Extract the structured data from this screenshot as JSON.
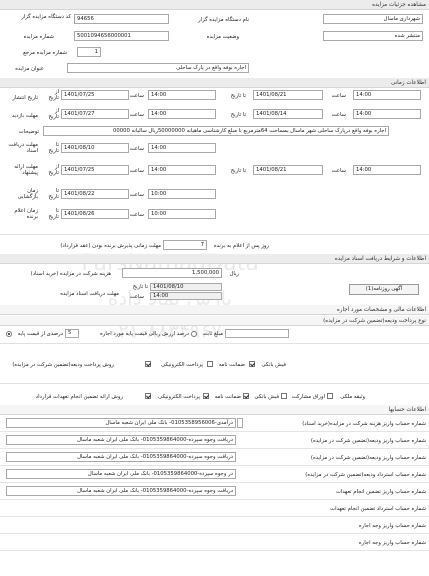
{
  "headers": {
    "detail": "مشاهده جزئیات مزایده",
    "timing": "اطلاعات زمانی",
    "terms": "اطلاعات و شرایط دریافت اسناد مزایده",
    "financial": "اطلاعات مالی و مشخصات مورد اجاره",
    "guarantee_type": "نوع پرداخت ودیعه(تضمین شرکت در مزایده)",
    "accounts": "اطلاعات حسابها"
  },
  "general": {
    "code_label": "کد دستگاه مزایده گزار",
    "code_value": "94656",
    "org_label": "نام دستگاه مزایده گزار",
    "org_value": "شهرداری ماسال",
    "number_label": "شماره مزایده",
    "number_value": "5001094656000001",
    "status_label": "وضعیت مزایده",
    "status_value": "منتشر شده",
    "ref_label": "شماره مزایده مرجع",
    "ref_value": "1",
    "subject_label": "عنوان مزایده",
    "subject_value": "اجاره  بوفه  واقع در پارک ساحلی"
  },
  "timing": {
    "from": "از تاریخ",
    "to": "تا تاریخ",
    "time": "ساعت",
    "publish_label": "تاریخ انتشار",
    "publish_from_date": "1401/07/25",
    "publish_from_time": "14:00",
    "publish_to_date": "1401/08/21",
    "publish_to_time": "14:00",
    "visit_label": "مهلت بازدید",
    "visit_from_date": "1401/07/27",
    "visit_from_time": "14:00",
    "visit_to_date": "1401/08/14",
    "visit_to_time": "14:00",
    "description_label": "توضیحات",
    "description_value": "اجاره بوفه واقع درپارک ساحلی شهر ماسال بمساحت 64مترمربع با مبلغ کارشناسی ماهیانه 50000000ریال سالیانه 00000",
    "doc_deadline_label": "مهلت دریافت اسناد",
    "doc_deadline_date": "1401/08/10",
    "doc_deadline_time": "14:00",
    "offer_deadline_label": "مهلت ارائه پیشنهاد",
    "offer_from_date": "1401/07/25",
    "offer_from_time": "14:00",
    "offer_to_date": "1401/08/21",
    "offer_to_time": "14:00",
    "opening_label": "زمان بازگشایی",
    "opening_date": "1401/08/22",
    "opening_time": "10:00",
    "winner_label": "زمان اعلام برنده",
    "winner_date": "1401/08/26",
    "winner_time": "10:00"
  },
  "terms": {
    "validity_label": "مهلت زمانی پذیرش برنده بودن (عقد قرارداد)",
    "validity_value": "7",
    "validity_suffix": "روز پس از اعلام به برنده",
    "fee_label": "هزینه شرکت در مزایده (خرید اسناد)",
    "fee_value": "1,500,000",
    "fee_unit": "ریال",
    "receipt_label": "مهلت دریافت اسناد مزایده",
    "receipt_to_label": "تا تاریخ",
    "receipt_date": "1401/08/10",
    "receipt_time_label": "ساعت",
    "receipt_time": "14:00",
    "newspaper_button": "آگهی روزنامه(1)"
  },
  "guarantee": {
    "percent_label": "درصدی از قیمت پایه",
    "percent_value": "5",
    "percent_suffix": "درصد ارزش ریالی قیمت پایه مورد اجاره",
    "fixed_label": "مبلغ ثابت"
  },
  "payment": {
    "deposit_label": "روش پرداخت ودیعه(تضمین شرکت در مزایده)",
    "electronic": "پرداخت الکترونیکی",
    "guarantee_letter": "ضمانت نامه",
    "bank_check": "فیش بانکی",
    "contract_label": "روش ارائه تضمین انجام تعهدات قرارداد",
    "c_electronic": "پرداخت الکترونیکی",
    "c_guarantee": "ضمانت نامه",
    "c_bank": "فیش بانکی",
    "c_partnership": "اوراق مشارکت",
    "c_property": "وثیقه ملکی"
  },
  "accounts": {
    "rows": [
      {
        "label": "شماره حساب واریز هزینه شرکت در مزایده(خرید اسناد)",
        "value": "درآمدی-0105358956006- بانک ملی ایران شعبه ماسال"
      },
      {
        "label": "شماره حساب واریز ودیعه(تضمین شرکت در مزایده)",
        "value": "دریافت وجوه سپرده-0105359864000- بانک ملی ایران شعبه ماسال"
      },
      {
        "label": "شماره حساب واریز ودیعه(تضمین شرکت در مزایده)",
        "value": "دریافت وجوه سپرده-0105359864000- بانک ملی ایران شعبه ماسال"
      },
      {
        "label": "شماره حساب استرداد ودیعه(تضمین شرکت در مزایده)",
        "value": "در وجوه سپرده-0105359864000- بانک ملی ایران شعبه ماسال"
      },
      {
        "label": "شماره حساب واریز تضمین انجام تعهدات",
        "value": "دریافت وجوه سپرده-0105359864000- بانک ملی ایران شعبه ماسال"
      },
      {
        "label": "شماره حساب استرداد تضمین انجام تعهدات",
        "value": ""
      },
      {
        "label": "شماره حساب واریز وجه اجاره",
        "value": ""
      },
      {
        "label": "شماره حساب واریز وجه اجاره",
        "value": ""
      }
    ]
  },
  "watermark": {
    "brand": "ParsNamadData",
    "company": "پارس نماد داده",
    "phone": "۰۲۱-۸۸۳۴۹۶۷۰"
  }
}
